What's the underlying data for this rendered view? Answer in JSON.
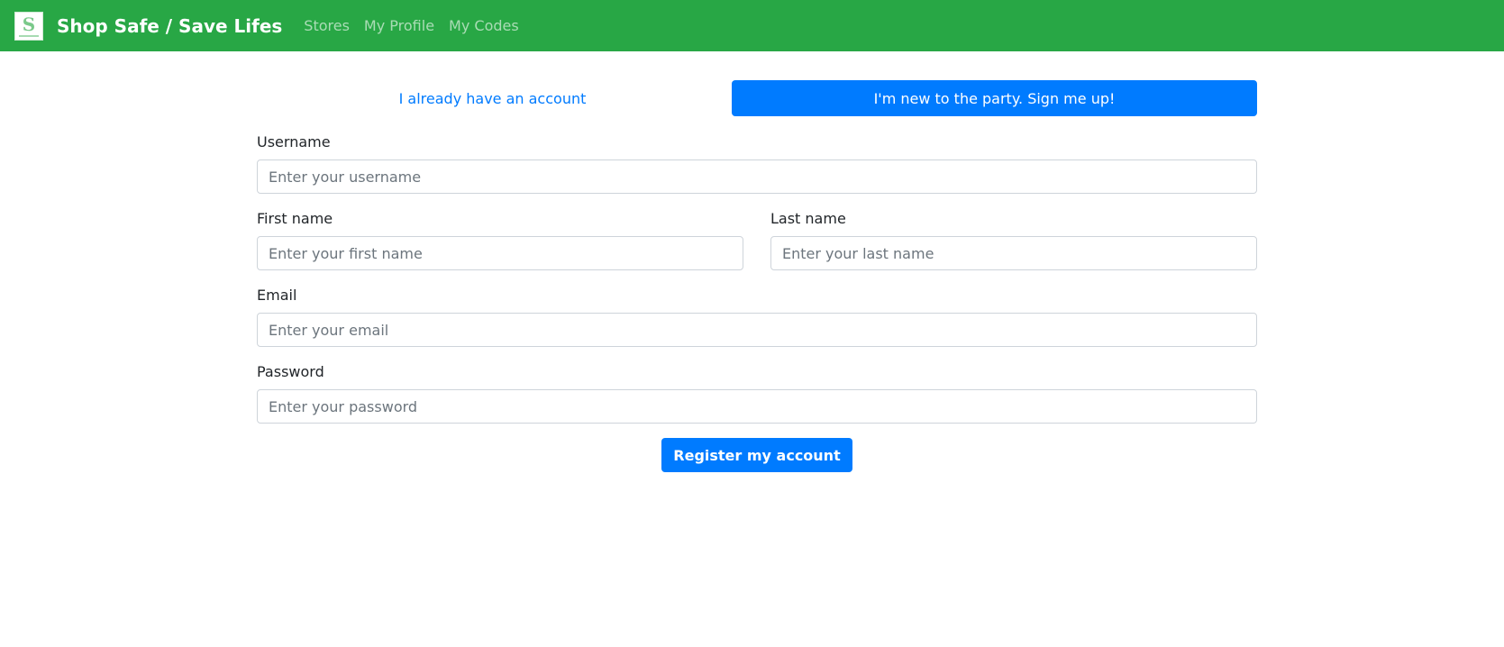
{
  "nav": {
    "brand": "Shop Safe / Save Lifes",
    "logo_icon": "shop-logo-icon",
    "links": [
      "Stores",
      "My Profile",
      "My Codes"
    ],
    "bg_color": "#28a745"
  },
  "tabs": {
    "login_label": "I already have an account",
    "signup_label": "I'm new to the party. Sign me up!",
    "active": "signup",
    "accent_color": "#007bff"
  },
  "form": {
    "username": {
      "label": "Username",
      "placeholder": "Enter your username",
      "value": ""
    },
    "first_name": {
      "label": "First name",
      "placeholder": "Enter your first name",
      "value": ""
    },
    "last_name": {
      "label": "Last name",
      "placeholder": "Enter your last name",
      "value": ""
    },
    "email": {
      "label": "Email",
      "placeholder": "Enter your email",
      "value": ""
    },
    "password": {
      "label": "Password",
      "placeholder": "Enter your password",
      "value": ""
    },
    "submit_label": "Register my account"
  }
}
